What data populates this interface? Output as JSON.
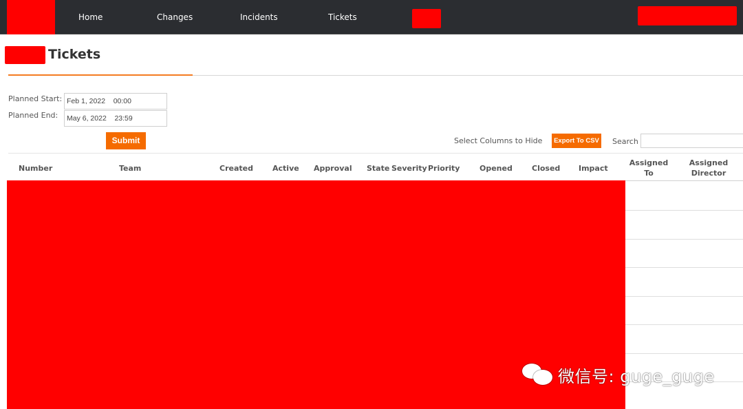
{
  "nav": {
    "items": [
      {
        "label": "Home"
      },
      {
        "label": "Changes"
      },
      {
        "label": "Incidents"
      },
      {
        "label": "Tickets"
      }
    ]
  },
  "page": {
    "title": "Tickets"
  },
  "filters": {
    "planned_start_label": "Planned Start:",
    "planned_start_value": "Feb 1, 2022    00:00",
    "planned_end_label": "Planned End:",
    "planned_end_value": "May 6, 2022    23:59",
    "submit_label": "Submit"
  },
  "toolbar": {
    "hide_columns_label": "Select Columns to Hide",
    "export_label": "Export To CSV",
    "search_label": "Search",
    "search_value": ""
  },
  "table": {
    "columns": [
      {
        "label": "Number"
      },
      {
        "label": "Team"
      },
      {
        "label": "Created"
      },
      {
        "label": "Active"
      },
      {
        "label": "Approval"
      },
      {
        "label": "State"
      },
      {
        "label": "Severity"
      },
      {
        "label": "Priority"
      },
      {
        "label": "Opened"
      },
      {
        "label": "Closed"
      },
      {
        "label": "Impact"
      },
      {
        "label": "Assigned\nTo"
      },
      {
        "label": "Assigned\nDirector"
      }
    ]
  },
  "watermark": {
    "text": "微信号: guge_guge"
  },
  "colors": {
    "navbar": "#2b2d31",
    "accent": "#f56b00",
    "redaction": "#ff0000"
  }
}
